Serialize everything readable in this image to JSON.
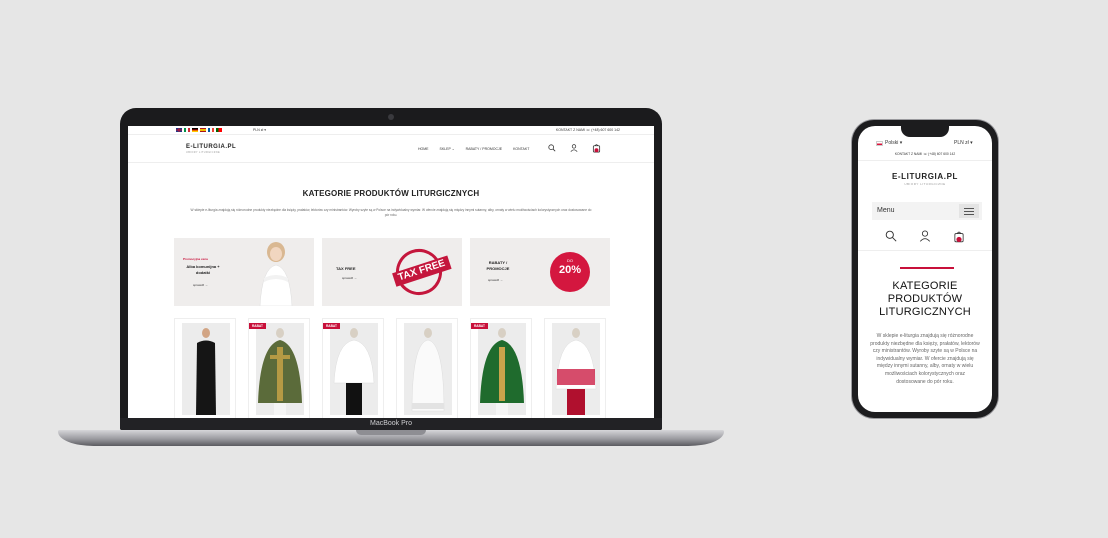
{
  "laptop": {
    "model_label": "MacBook Pro",
    "topbar": {
      "flags": [
        {
          "icon": "flag-uk-icon",
          "colors": [
            "#1d3a8a",
            "#c8102e",
            "#ffffff"
          ]
        },
        {
          "icon": "flag-italy-icon",
          "colors": [
            "#009246",
            "#ffffff",
            "#ce2b37"
          ]
        },
        {
          "icon": "flag-germany-icon",
          "colors": [
            "#000000",
            "#dd0000",
            "#ffce00"
          ]
        },
        {
          "icon": "flag-spain-icon",
          "colors": [
            "#aa151b",
            "#f1bf00",
            "#aa151b"
          ]
        },
        {
          "icon": "flag-france-icon",
          "colors": [
            "#0055a4",
            "#ffffff",
            "#ef4135"
          ]
        },
        {
          "icon": "flag-portugal-icon",
          "colors": [
            "#006600",
            "#ff0000",
            "#ff0000"
          ]
        }
      ],
      "currency": "PLN zł ▾",
      "contact": "KONTAKT Z NAMI ☏ (+48) 607 600 142"
    },
    "navbar": {
      "logo": "E-LITURGIA.PL",
      "logo_sub": "UBIORY LITURGICZNE",
      "links": [
        "HOME",
        "SKLEP ⌄",
        "RABATY / PROMOCJE",
        "KONTAKT"
      ]
    },
    "hero": {
      "title": "KATEGORIE PRODUKTÓW LITURGICZNYCH",
      "desc": "W sklepie e-liturgia znajdują się różnorodne produkty niezbędne dla księży, prałatów, lektorów czy ministrantów. Wyroby szyte są w Polsce na indywidualny wymiar. W ofercie znajdują się między innymi sutanny, alby, ornaty w wielu możliwościach kolorystycznych oraz dostosowane do pór roku."
    },
    "banners": [
      {
        "promo": "Promocyjna cena",
        "title_line1": "Alba komunijna +",
        "title_line2": "dodatki",
        "link": "sprawdź →"
      },
      {
        "title": "TAX FREE",
        "stamp": "TAX FREE",
        "link": "sprawdź →"
      },
      {
        "title_line1": "RABATY /",
        "title_line2": "PROMOCJE",
        "badge_small": "DO",
        "badge": "20%",
        "link": "sprawdź →"
      }
    ],
    "products": [
      {
        "badge": "",
        "garment": "black-cassock",
        "color": "#1a1a1a"
      },
      {
        "badge": "RABAT",
        "garment": "green-gold-chasuble",
        "color": "#5b6b3a"
      },
      {
        "badge": "RABAT",
        "garment": "white-surplice",
        "color": "#ffffff"
      },
      {
        "badge": "",
        "garment": "white-alb",
        "color": "#fafafa"
      },
      {
        "badge": "RABAT",
        "garment": "green-chasuble",
        "color": "#1f6b2d"
      },
      {
        "badge": "",
        "garment": "red-lace-surplice",
        "color": "#c8103a"
      }
    ]
  },
  "phone": {
    "language": "Polski ▾",
    "currency": "PLN zł ▾",
    "contact": "KONTAKT Z NAMI ☏ (+48) 607 600 142",
    "logo": "E-LITURGIA.PL",
    "logo_sub": "UBIORY LITURGICZNE",
    "menu_label": "Menu",
    "title_line1": "KATEGORIE",
    "title_line2": "PRODUKTÓW",
    "title_line3": "LITURGICZNYCH",
    "desc": "W sklepie e-liturgia znajdują się różnorodne produkty niezbędne dla księży, prałatów, lektorów czy ministrantów. Wyroby szyte są w Polsce na indywidualny wymiar. W ofercie znajdują się między innymi sutanny, alby, ornaty w wielu możliwościach kolorystycznych oraz dostosowane do pór roku."
  },
  "colors": {
    "accent": "#c8103a",
    "bg": "#e6e6e6",
    "banner_bg": "#efedec"
  }
}
